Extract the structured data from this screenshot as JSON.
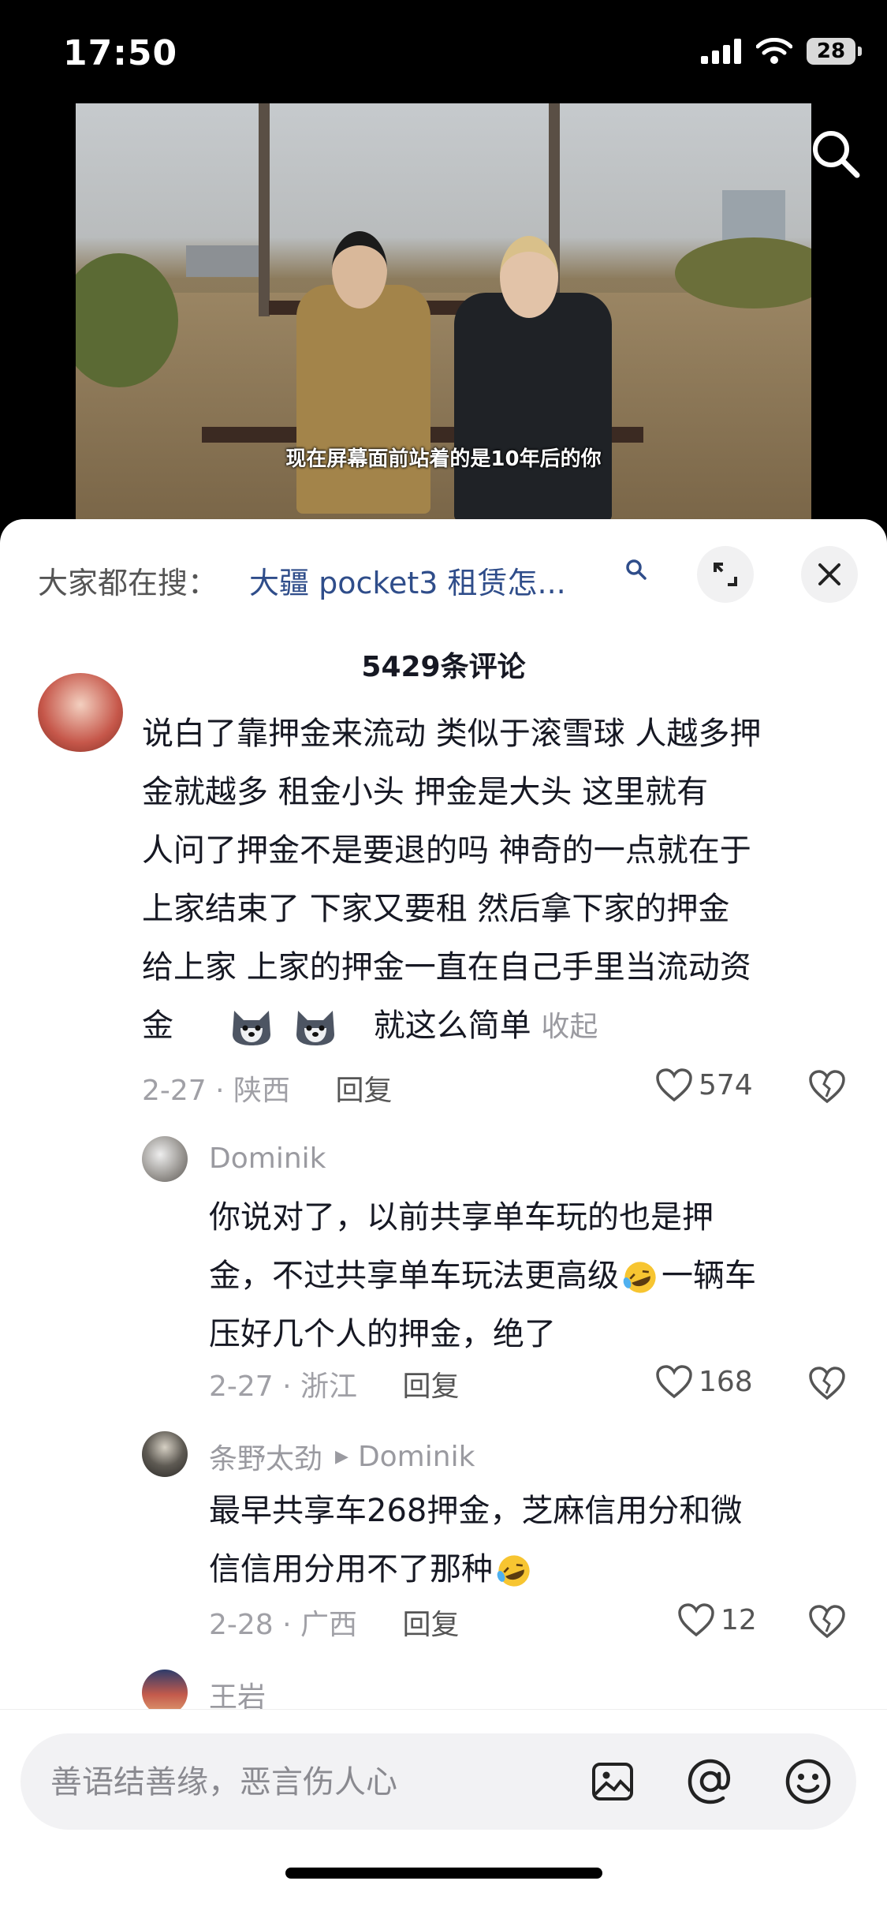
{
  "status_bar": {
    "time": "17:50",
    "battery": "28"
  },
  "video": {
    "subtitle": "现在屏幕面前站着的是10年后的你"
  },
  "sheet": {
    "hot_search_prefix": "大家都在搜：",
    "hot_search_query": "大疆 pocket3 租赁怎...",
    "comment_count": "5429条评论"
  },
  "comments": [
    {
      "text_lines": [
        "说白了靠押金来流动  类似于滚雪球  人越多押",
        "金就越多    租金小头   押金是大头   这里就有",
        "人问了押金不是要退的吗   神奇的一点就在于",
        "上家结束了   下家又要租    然后拿下家的押金",
        "给上家   上家的押金一直在自己手里当流动资"
      ],
      "last_line_start": "金",
      "last_line_end": "就这么简单",
      "fold_label": "收起",
      "date_location": "2-27 · 陕西",
      "reply_label": "回复",
      "likes": "574"
    }
  ],
  "replies": [
    {
      "name": "Dominik",
      "text_lines": [
        "你说对了，以前共享单车玩的也是押",
        "金，不过共享单车玩法更高级",
        "压好几个人的押金，绝了"
      ],
      "text_line2_after": "一辆车",
      "date_location": "2-27 · 浙江",
      "reply_label": "回复",
      "likes": "168"
    },
    {
      "name": "条野太劲",
      "reply_to": "Dominik",
      "text_lines": [
        "最早共享车268押金，芝麻信用分和微",
        "信信用分用不了那种"
      ],
      "date_location": "2-28 · 广西",
      "reply_label": "回复",
      "likes": "12"
    },
    {
      "name": "王岩"
    }
  ],
  "input": {
    "placeholder": "善语结善缘，恶言伤人心"
  },
  "icons": {
    "search": "search-icon",
    "expand": "expand-icon",
    "close": "close-icon",
    "like": "heart-icon",
    "dislike": "broken-heart-icon",
    "image": "image-icon",
    "mention": "at-icon",
    "emoji": "smiley-icon"
  }
}
